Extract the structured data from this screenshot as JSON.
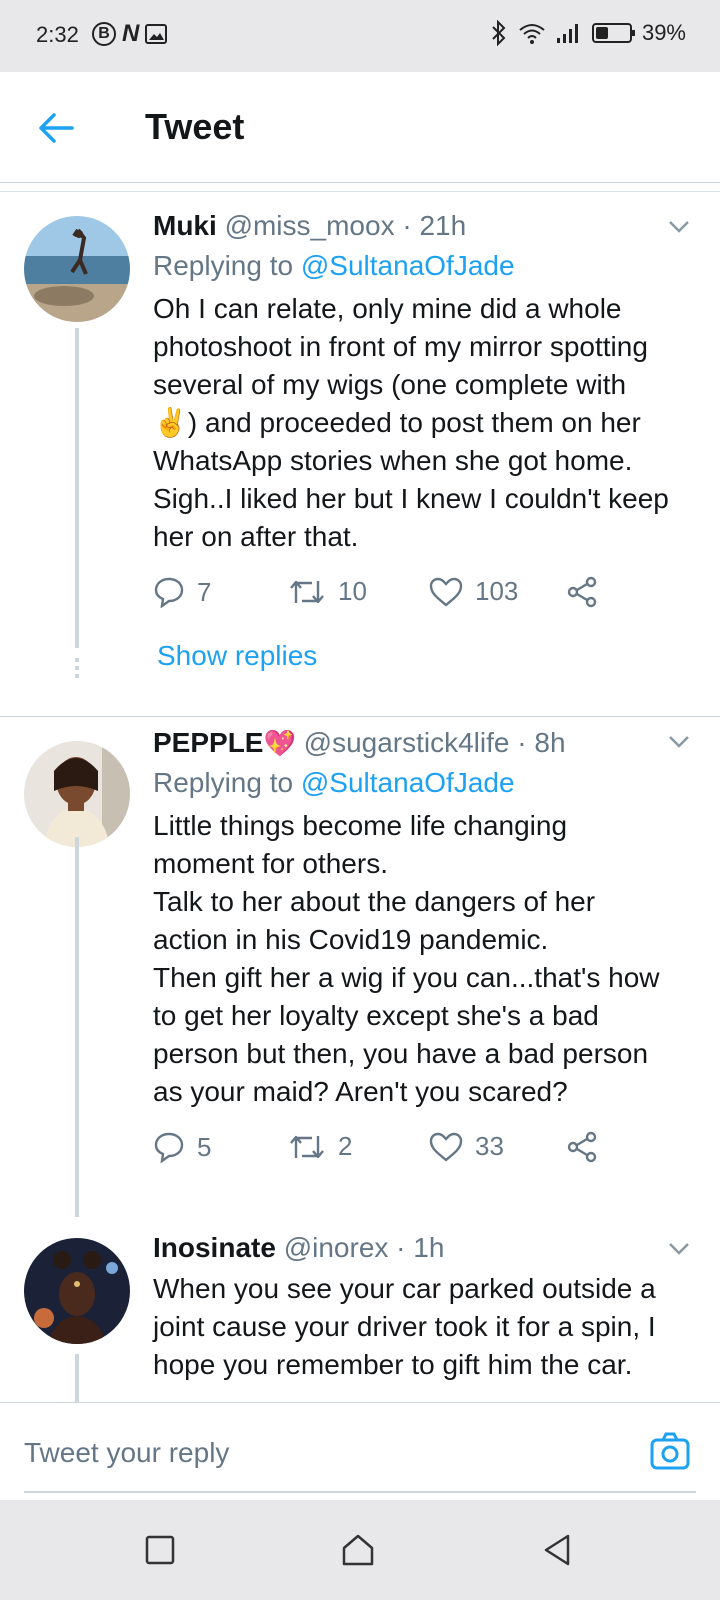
{
  "status_bar": {
    "time": "2:32",
    "battery_text": "39%",
    "battery_level": 0.39,
    "icons": [
      "b-circle-icon",
      "n-icon",
      "image-icon",
      "bluetooth-icon",
      "wifi-icon",
      "signal-icon",
      "battery-charging-icon"
    ]
  },
  "header": {
    "title": "Tweet"
  },
  "tweets": [
    {
      "name": "Muki",
      "handle": "@miss_moox",
      "time": "· 21h",
      "replying_prefix": "Replying to",
      "replying_to": "@SultanaOfJade",
      "body": "Oh I can relate, only mine did a whole\nphotoshoot in front of my mirror spotting\nseveral of my wigs (one complete with\n✌️) and proceeded to post them on her\nWhatsApp stories when she got home.\nSigh..I liked her but I knew I couldn't keep\nher on after that.",
      "replies": "7",
      "retweets": "10",
      "likes": "103",
      "show_replies": "Show replies"
    },
    {
      "name": "PEPPLE",
      "name_emoji": "💖",
      "handle": "@sugarstick4life",
      "time": "· 8h",
      "replying_prefix": "Replying to",
      "replying_to": "@SultanaOfJade",
      "body": "Little things become life changing\nmoment for others.\nTalk to her about the dangers of her\naction in his Covid19 pandemic.\nThen gift her a wig if you can...that's how\nto get her loyalty except she's a bad\nperson but then, you have a bad person\nas your maid? Aren't you scared?",
      "replies": "5",
      "retweets": "2",
      "likes": "33"
    },
    {
      "name": "Inosinate",
      "handle": "@inorex",
      "time": "· 1h",
      "body": "When you see your car parked outside a\njoint cause your driver took it for a spin, I\nhope you remember to gift him the car."
    }
  ],
  "reply_bar": {
    "placeholder": "Tweet your reply"
  },
  "colors": {
    "accent": "#1da1f2",
    "secondary_text": "#657786",
    "divider": "#ccd6dd"
  }
}
